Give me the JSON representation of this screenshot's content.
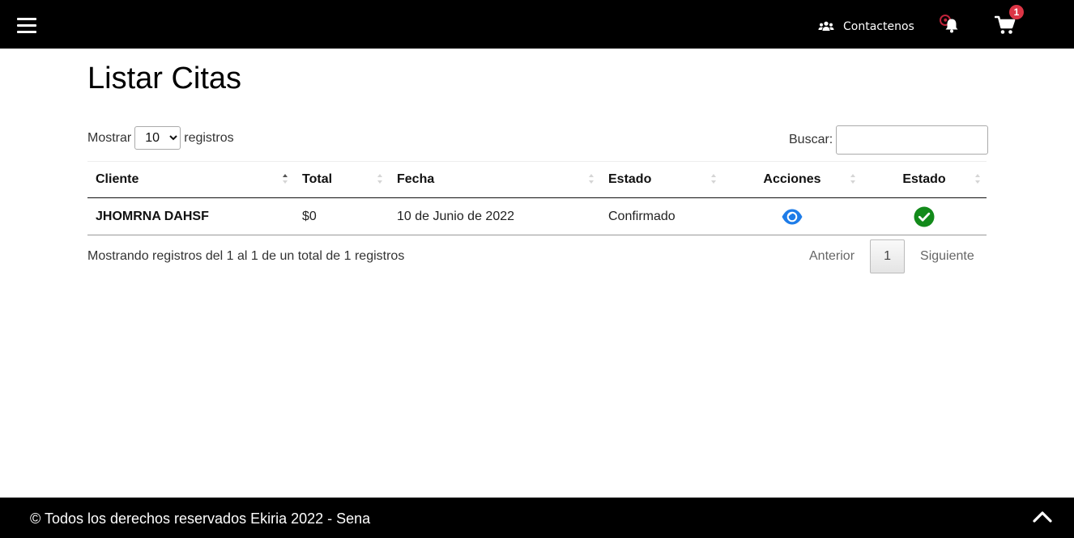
{
  "nav": {
    "menu_icon": "hamburger-icon",
    "contact_label": "Contactenos",
    "contact_icon": "users-icon",
    "notification_icon": "bell-icon",
    "cart_icon": "cart-icon",
    "cart_count": "1"
  },
  "page": {
    "title": "Listar Citas"
  },
  "length": {
    "prefix": "Mostrar",
    "selected": "10",
    "suffix": "registros"
  },
  "search": {
    "label": "Buscar:",
    "value": ""
  },
  "table": {
    "headers": [
      "Cliente",
      "Total",
      "Fecha",
      "Estado",
      "Acciones",
      "Estado"
    ],
    "rows": [
      {
        "cliente": "JHOMRNA DAHSF",
        "total": "$0",
        "fecha": "10 de Junio de 2022",
        "estado": "Confirmado",
        "accion_icon": "eye-icon",
        "estado_icon": "check-circle-icon"
      }
    ]
  },
  "pagination": {
    "info": "Mostrando registros del 1 al 1 de un total de 1 registros",
    "previous": "Anterior",
    "current_page": "1",
    "next": "Siguiente"
  },
  "footer": {
    "copyright": "© Todos los derechos reservados Ekiria 2022 - Sena",
    "scroll_top_icon": "chevron-up-icon"
  },
  "colors": {
    "header_bg": "#000000",
    "badge": "#dc3545",
    "eye": "#1e7ce8",
    "check": "#128a1a"
  }
}
